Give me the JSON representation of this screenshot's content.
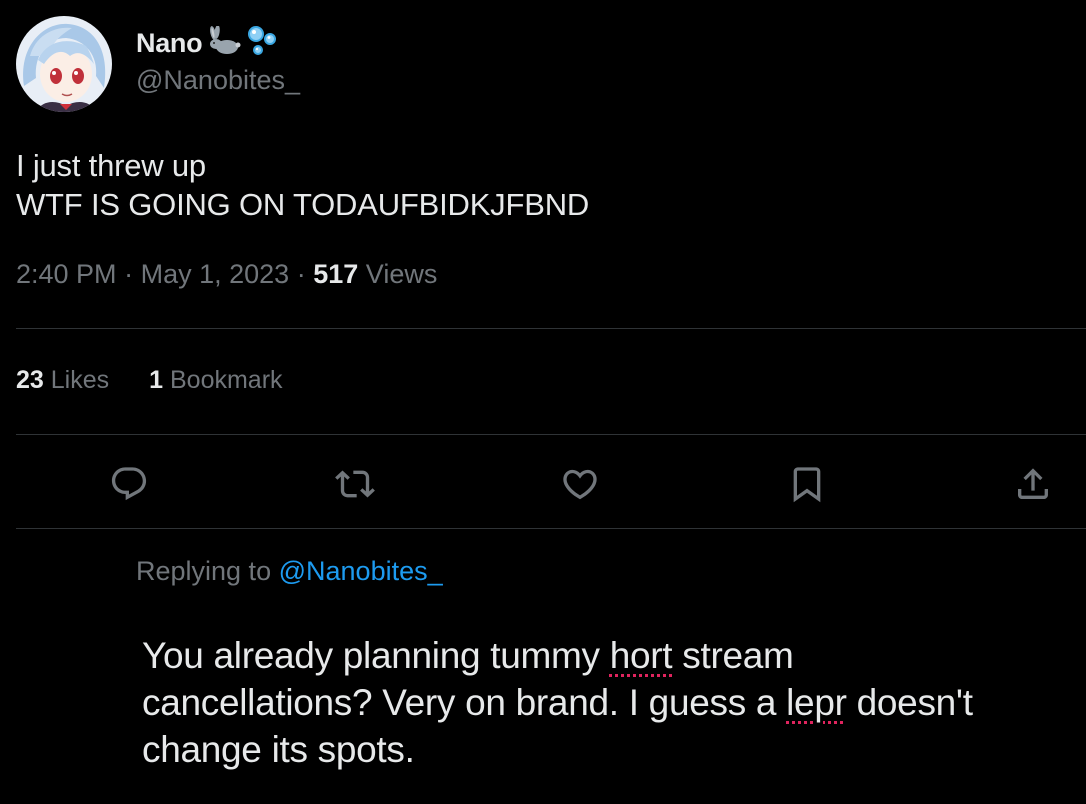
{
  "author": {
    "display_name": "Nano",
    "name_emojis": [
      "rabbit-emoji",
      "bubbles-emoji"
    ],
    "handle": "@Nanobites_"
  },
  "tweet": {
    "lines": [
      "I just threw up",
      "WTF IS GOING ON TODAUFBIDKJFBND"
    ],
    "time": "2:40 PM",
    "separator": "·",
    "date": "May 1, 2023",
    "views_count": "517",
    "views_label": "Views"
  },
  "stats": {
    "likes_count": "23",
    "likes_label": "Likes",
    "bookmarks_count": "1",
    "bookmarks_label": "Bookmark"
  },
  "actions": [
    "reply-icon",
    "retweet-icon",
    "like-icon",
    "bookmark-icon",
    "share-icon"
  ],
  "reply": {
    "replying_prefix": "Replying to",
    "replying_handle": "@Nanobites_",
    "line1_pre": "You already planning tummy ",
    "line1_misspelled": "hort",
    "line1_post": " stream",
    "line2_pre": "cancellations? Very on brand. I guess a ",
    "line2_misspelled": "lepr",
    "line2_post": " doesn't",
    "line3": "change its spots."
  },
  "colors": {
    "background": "#000000",
    "text_primary": "#e7e9ea",
    "text_secondary": "#71767b",
    "divider": "#2f3336",
    "link": "#1d9bf0",
    "spellcheck": "#e0245e"
  }
}
